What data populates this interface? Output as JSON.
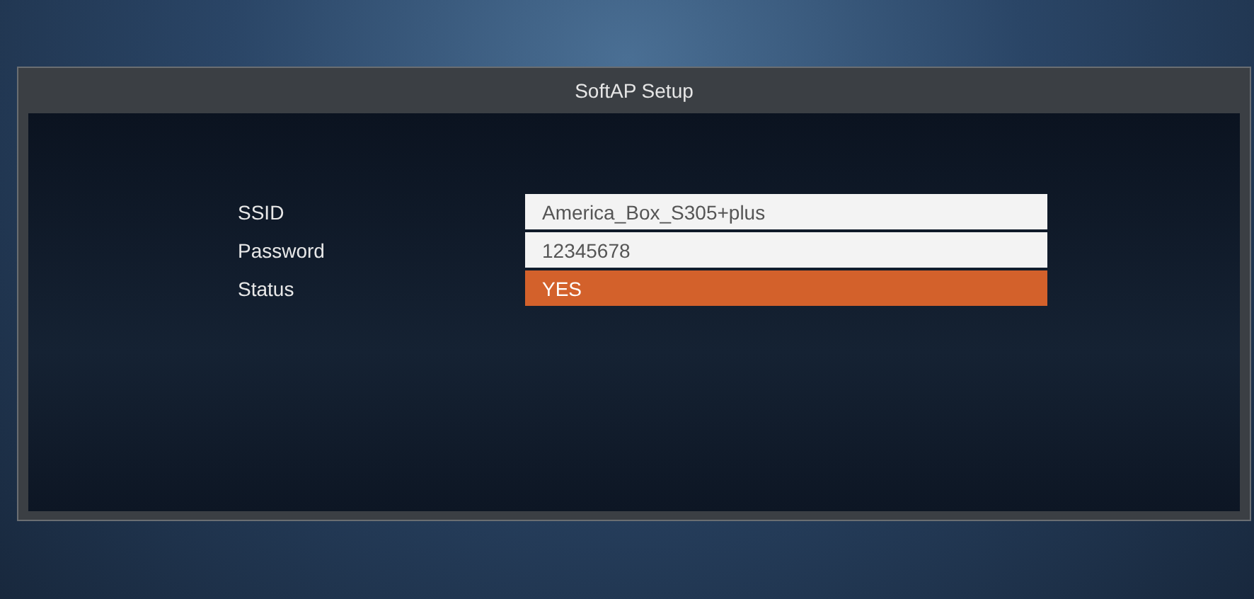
{
  "dialog": {
    "title": "SoftAP Setup"
  },
  "rows": [
    {
      "label": "SSID",
      "value": "America_Box_S305+plus",
      "selected": false
    },
    {
      "label": "Password",
      "value": "12345678",
      "selected": false
    },
    {
      "label": "Status",
      "value": "YES",
      "selected": true
    }
  ]
}
